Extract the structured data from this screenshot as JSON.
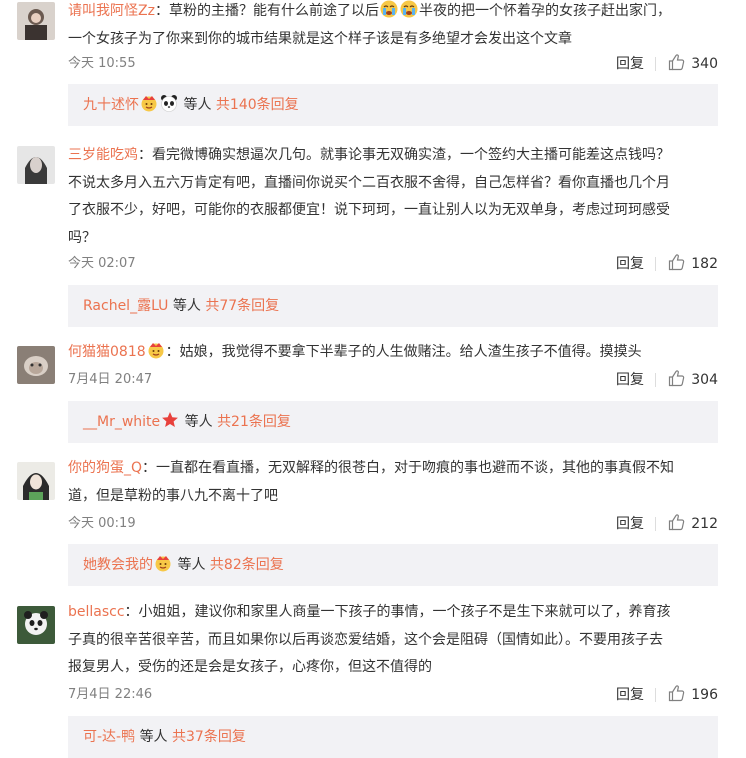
{
  "comments": [
    {
      "username": "请叫我阿怪Zz",
      "text_a": "：草粉的主播？能有什么前途了以后",
      "text_b": "半夜的把一个怀着孕的女孩子赶出家门，",
      "text_c": "一个女孩子为了你来到你的城市结果就是这个样子该是有多绝望才会发出这个文章",
      "time": "今天 10:55",
      "reply_label": "回复",
      "likes": "340",
      "reply_user": "九十述怀",
      "reply_mid": "等人",
      "reply_total": "共140条回复"
    },
    {
      "username": "三岁能吃鸡",
      "text_a": "：看完微博确实想逼次几句。就事论事无双确实渣，一个签约大主播可能差这点钱吗？",
      "text_b": "不说太多月入五六万肯定有吧，直播间你说买个二百衣服不舍得，自己怎样省？看你直播也几个月",
      "text_c": "了衣服不少，好吧，可能你的衣服都便宜！说下珂珂，一直让别人以为无双单身，考虑过珂珂感受",
      "text_d": "吗？",
      "time": "今天 02:07",
      "reply_label": "回复",
      "likes": "182",
      "reply_user": "Rachel_露LU",
      "reply_mid": "等人",
      "reply_total": "共77条回复"
    },
    {
      "username": "何猫猫0818",
      "text_a": "：姑娘，我觉得不要拿下半辈子的人生做赌注。给人渣生孩子不值得。摸摸头",
      "time": "7月4日 20:47",
      "reply_label": "回复",
      "likes": "304",
      "reply_user": "__Mr_white",
      "reply_mid": "等人",
      "reply_total": "共21条回复"
    },
    {
      "username": "你的狗蛋_Q",
      "text_a": "：一直都在看直播，无双解释的很苍白，对于吻痕的事也避而不谈，其他的事真假不知",
      "text_b": "道，但是草粉的事八九不离十了吧",
      "time": "今天 00:19",
      "reply_label": "回复",
      "likes": "212",
      "reply_user": "她教会我的",
      "reply_mid": "等人",
      "reply_total": "共82条回复"
    },
    {
      "username": "bellascc",
      "text_a": "：小姐姐，建议你和家里人商量一下孩子的事情，一个孩子不是生下来就可以了，养育孩",
      "text_b": "子真的很辛苦很辛苦，而且如果你以后再谈恋爱结婚，这个会是阻碍（国情如此）。不要用孩子去",
      "text_c": "报复男人，受伤的还是会是女孩子，心疼你，但这不值得的",
      "time": "7月4日 22:46",
      "reply_label": "回复",
      "likes": "196",
      "reply_user": "可-达-鸭",
      "reply_mid": "等人",
      "reply_total": "共37条回复"
    }
  ],
  "colors": {
    "username": "#eb7350",
    "text": "#333333",
    "meta": "#808080",
    "reply_bg": "#f2f2f5"
  },
  "icons": {
    "like": "thumbs-up-icon",
    "emoji_cry": "crying-face-emoji",
    "emoji_panda": "panda-emoji",
    "emoji_star": "red-star-icon"
  }
}
